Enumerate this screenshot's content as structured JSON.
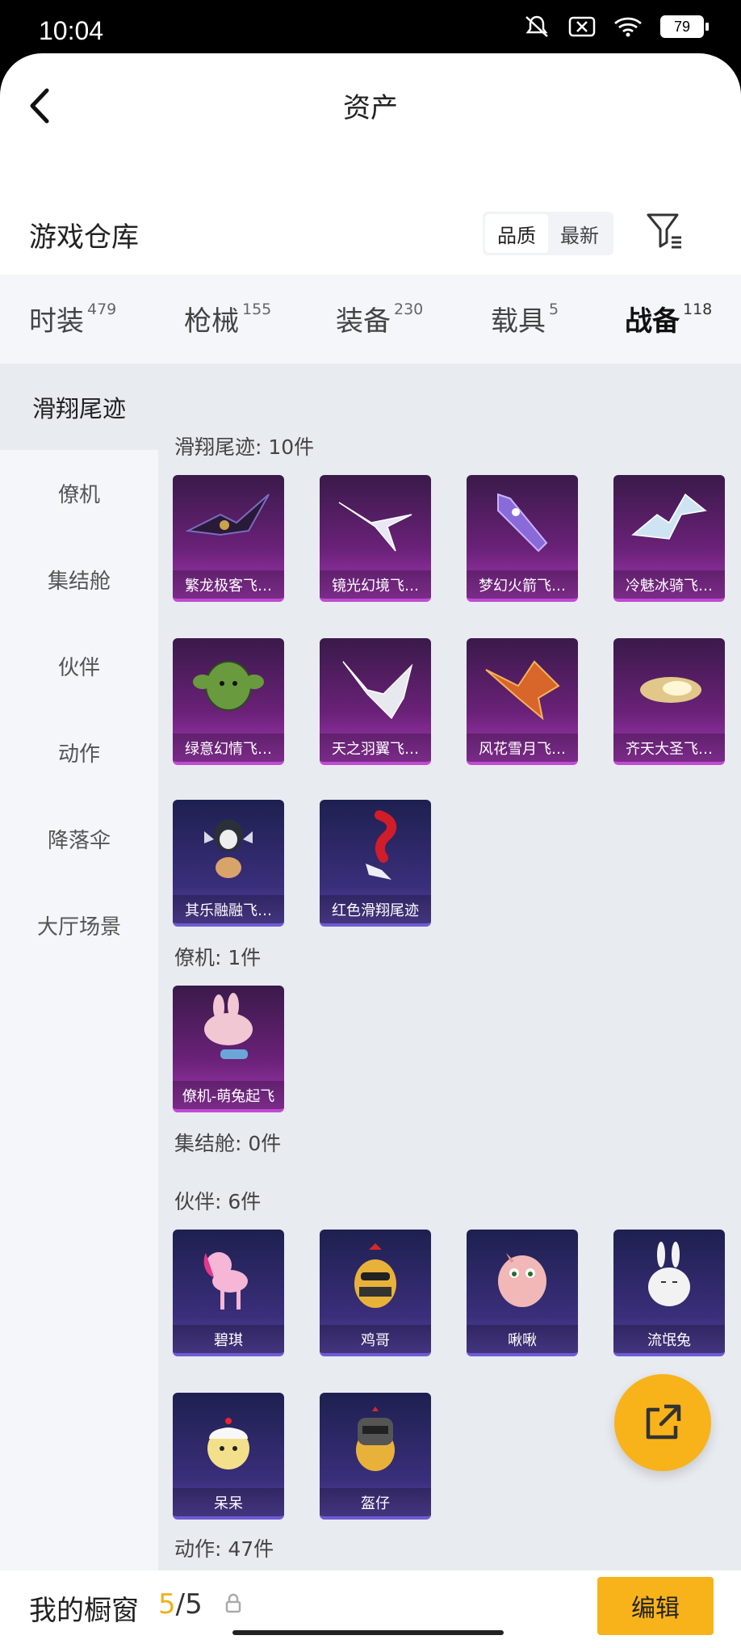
{
  "status": {
    "time": "10:04",
    "battery": "79"
  },
  "header": {
    "title": "资产"
  },
  "warehouse": {
    "title": "游戏仓库",
    "sort_quality": "品质",
    "sort_newest": "最新"
  },
  "tabs": [
    {
      "label": "时装",
      "count": "479"
    },
    {
      "label": "枪械",
      "count": "155"
    },
    {
      "label": "装备",
      "count": "230"
    },
    {
      "label": "载具",
      "count": "5"
    },
    {
      "label": "战备",
      "count": "118"
    }
  ],
  "sidebar": [
    "滑翔尾迹",
    "僚机",
    "集结舱",
    "伙伴",
    "动作",
    "降落伞",
    "大厅场景"
  ],
  "groups": {
    "trail": {
      "title": "滑翔尾迹: 10件",
      "items": [
        "繁龙极客飞…",
        "镜光幻境飞…",
        "梦幻火箭飞…",
        "冷魅冰骑飞…",
        "绿意幻情飞…",
        "天之羽翼飞…",
        "风花雪月飞…",
        "齐天大圣飞…",
        "其乐融融飞…",
        "红色滑翔尾迹"
      ]
    },
    "wingman": {
      "title": "僚机: 1件",
      "items": [
        "僚机-萌兔起飞"
      ]
    },
    "capsule": {
      "title": "集结舱: 0件"
    },
    "partner": {
      "title": "伙伴: 6件",
      "items": [
        "碧琪",
        "鸡哥",
        "啾啾",
        "流氓兔",
        "呆呆",
        "盔仔"
      ]
    },
    "action": {
      "title": "动作: 47件"
    }
  },
  "bottom": {
    "showcase": "我的橱窗",
    "current": "5",
    "separator": "/",
    "total": "5",
    "edit": "编辑"
  }
}
